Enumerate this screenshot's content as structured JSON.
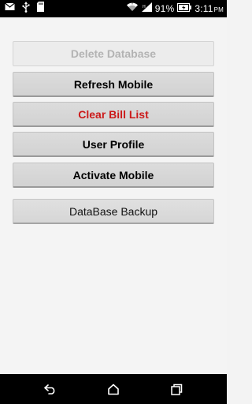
{
  "status_bar": {
    "icons_left": [
      "message-icon",
      "usb-icon",
      "sd-card-icon"
    ],
    "icons_right": [
      "wifi-icon",
      "signal-icon",
      "battery-icon"
    ],
    "battery_percent": "91%",
    "time": "3:11",
    "time_suffix": "PM"
  },
  "buttons": {
    "delete_database": "Delete Database",
    "refresh_mobile": "Refresh Mobile",
    "clear_bill_list": "Clear Bill List",
    "user_profile": "User Profile",
    "activate_mobile": "Activate Mobile",
    "database_backup": "DataBase Backup"
  },
  "colors": {
    "clear_bill_list_text": "#cc1a1a",
    "disabled_text": "#b3b3b3"
  },
  "nav_bar": {
    "icons": [
      "back-icon",
      "home-icon",
      "recent-apps-icon"
    ]
  }
}
